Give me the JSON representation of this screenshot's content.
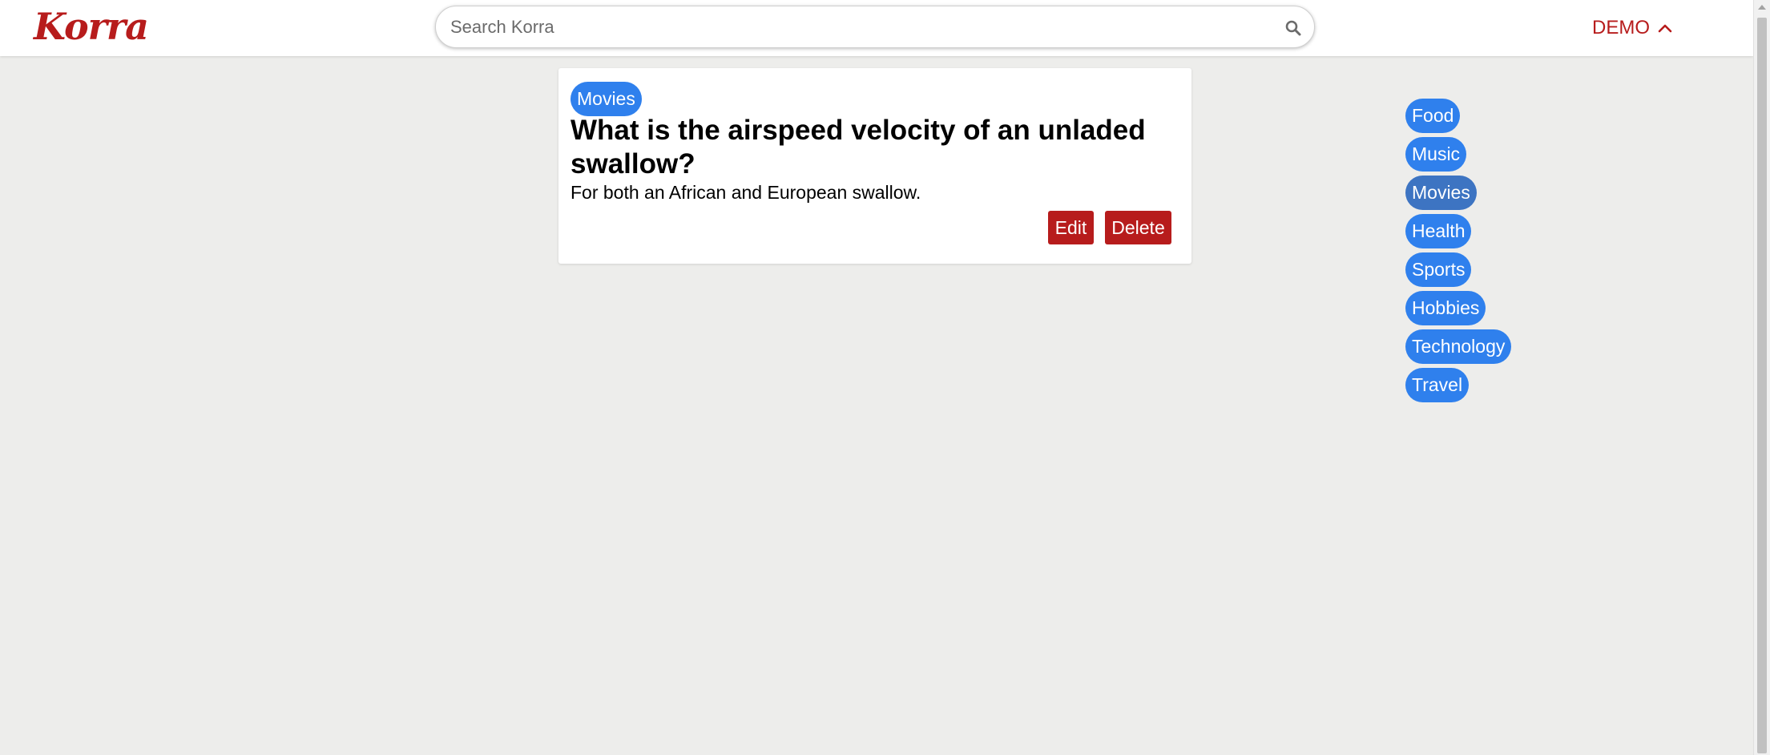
{
  "header": {
    "logo": "Korra",
    "search": {
      "placeholder": "Search Korra",
      "value": ""
    },
    "user_menu": {
      "label": "DEMO"
    }
  },
  "question": {
    "category": "Movies",
    "title": "What is the airspeed velocity of an unladed swallow?",
    "description": "For both an African and European swallow.",
    "edit_label": "Edit",
    "delete_label": "Delete"
  },
  "sidebar": {
    "categories": [
      {
        "label": "Food"
      },
      {
        "label": "Music"
      },
      {
        "label": "Movies",
        "active": true
      },
      {
        "label": "Health"
      },
      {
        "label": "Sports"
      },
      {
        "label": "Hobbies"
      },
      {
        "label": "Technology"
      },
      {
        "label": "Travel"
      }
    ]
  },
  "colors": {
    "brand": "#b71c1c",
    "pill": "#2f80ed",
    "pill_active": "#3d74c2",
    "background": "#ededeb"
  }
}
